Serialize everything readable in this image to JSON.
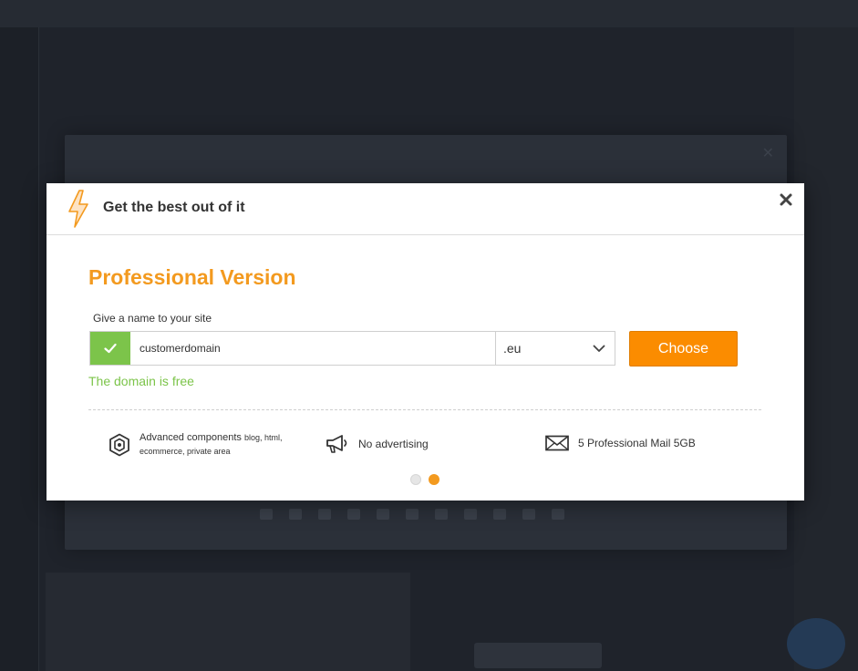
{
  "modal": {
    "title": "Get the best out of it",
    "section_title": "Professional Version",
    "field_label": "Give a name to your site",
    "domain_value": "customerdomain",
    "tld_selected": ".eu",
    "choose_label": "Choose",
    "status_text": "The domain is free"
  },
  "features": [
    {
      "icon": "hexagon-component-icon",
      "label": "Advanced components",
      "detail_line1": "blog, html,",
      "detail_line2": "ecommerce, private area"
    },
    {
      "icon": "megaphone-icon",
      "label": "No advertising"
    },
    {
      "icon": "envelope-icon",
      "label": "5 Professional Mail 5GB"
    }
  ],
  "carousel": {
    "total": 2,
    "active_index": 1
  },
  "colors": {
    "accent_orange": "#fb8c00",
    "title_orange": "#f39a1f",
    "success_green": "#7cc44a",
    "overlay_dark": "#1f232b"
  }
}
